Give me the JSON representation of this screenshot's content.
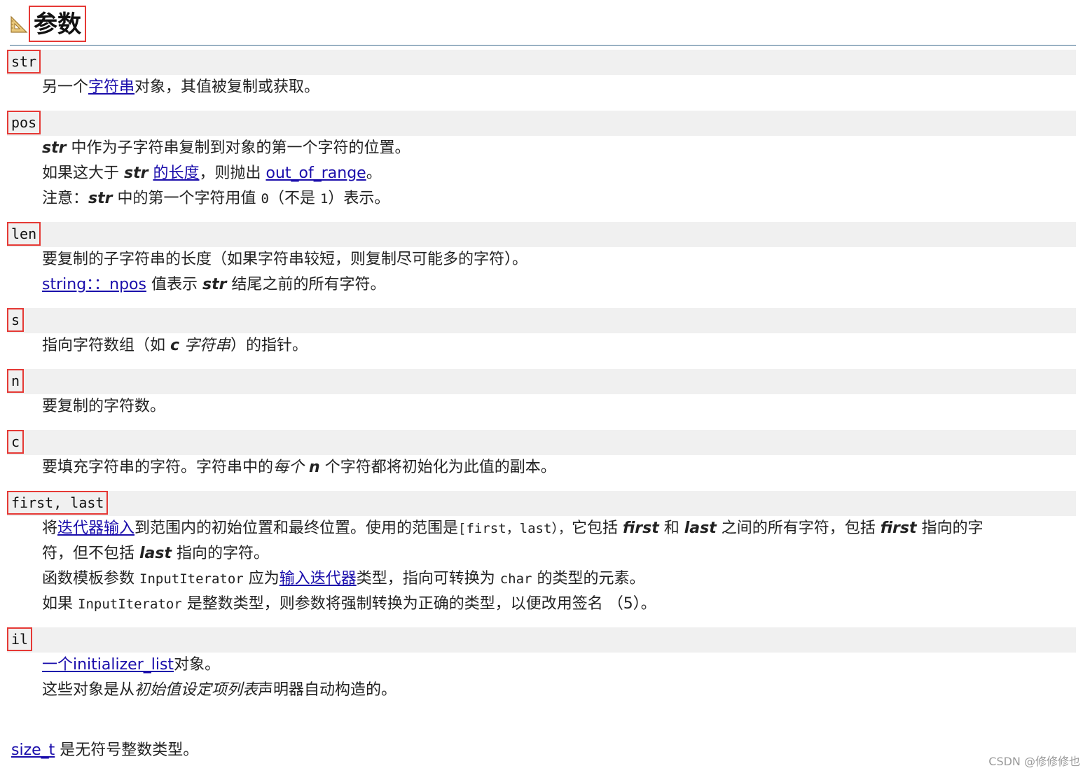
{
  "title": "参数",
  "params": {
    "str": {
      "name": "str",
      "l1_a": "另一个",
      "l1_link": "字符串",
      "l1_b": "对象，其值被复制或获取。"
    },
    "pos": {
      "name": "pos",
      "l1_em": "str",
      "l1_b": " 中作为子字符串复制到对象的第一个字符的位置。",
      "l2_a": "如果这大于 ",
      "l2_em": "str",
      "l2_sp": " ",
      "l2_link1": "的长度",
      "l2_b": "，则抛出 ",
      "l2_link2": "out_of_range",
      "l2_c": "。",
      "l3_a": "注意：",
      "l3_em": "str",
      "l3_b": " 中的第一个字符用值 ",
      "l3_code0": "0",
      "l3_c": "（不是 ",
      "l3_code1": "1",
      "l3_d": "）表示。"
    },
    "len": {
      "name": "len",
      "l1": "要复制的子字符串的长度（如果字符串较短，则复制尽可能多的字符）。",
      "l2_link": "string：：npos",
      "l2_a": " 值表示 ",
      "l2_em": "str",
      "l2_b": " 结尾之前的所有字符。"
    },
    "s": {
      "name": "s",
      "l1_a": "指向字符数组（如 ",
      "l1_em": "c",
      "l1_it": " 字符串",
      "l1_b": "）的指针。"
    },
    "n": {
      "name": "n",
      "l1": "要复制的字符数。"
    },
    "c": {
      "name": "c",
      "l1_a": "要填充字符串的字符。字符串中的",
      "l1_it": "每个",
      "l1_sp": " ",
      "l1_em": "n",
      "l1_b": " 个字符都将初始化为此值的副本。"
    },
    "first_last": {
      "name": "first, last",
      "l1_a": "将",
      "l1_link": "迭代器输入",
      "l1_b": "到范围内的初始位置和最终位置。使用的范围是",
      "l1_code": "[first，last），",
      "l1_c": "它包括 ",
      "l1_em1": "first",
      "l1_d": " 和 ",
      "l1_em2": "last",
      "l1_e": " 之间的所有字符，包括 ",
      "l1_em3": "first",
      "l1_f": " 指向的字",
      "l2_a": "符，但不包括 ",
      "l2_em": "last",
      "l2_b": " 指向的字符。",
      "l3_a": "函数模板参数 ",
      "l3_code": "InputIterator",
      "l3_b": " 应为",
      "l3_link": "输入迭代器",
      "l3_c": "类型，指向可转换为 ",
      "l3_code2": "char",
      "l3_d": " 的类型的元素。",
      "l4_a": "如果 ",
      "l4_code": "InputIterator",
      "l4_b": " 是整数类型，则参数将强制转换为正确的类型，以便改用签名 （5）。"
    },
    "il": {
      "name": "il",
      "l1_link": "一个initializer_list",
      "l1_a": "对象。",
      "l2_a": "这些对象是从",
      "l2_it": "初始值设定项列表",
      "l2_b": "声明器自动构造的。"
    }
  },
  "footer": {
    "link": "size_t",
    "text": " 是无符号整数类型。"
  },
  "watermark": "CSDN @修修修也",
  "colors": {
    "highlight_border": "#e53935",
    "link": "#1a0dab",
    "param_bar": "#f0f0f0",
    "header_rule": "#3c6a8c"
  }
}
